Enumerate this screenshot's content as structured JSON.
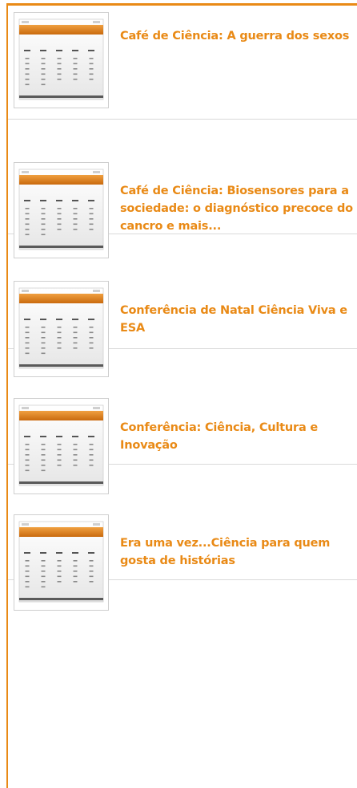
{
  "events": [
    {
      "title": "Café de Ciência: A guerra dos sexos",
      "thumbnail_icon": "calendar-icon"
    },
    {
      "title": "Café de Ciência: Biosensores para a sociedade: o diagnóstico precoce do cancro e mais...",
      "thumbnail_icon": "calendar-icon"
    },
    {
      "title": "Conferência de Natal Ciência Viva e ESA",
      "thumbnail_icon": "calendar-icon"
    },
    {
      "title": "Conferência: Ciência, Cultura e Inovação",
      "thumbnail_icon": "calendar-icon"
    },
    {
      "title": "Era uma vez...Ciência para quem gosta de histórias",
      "thumbnail_icon": "calendar-icon"
    }
  ],
  "colors": {
    "accent": "#e98a16",
    "divider": "#d9d9d9"
  }
}
